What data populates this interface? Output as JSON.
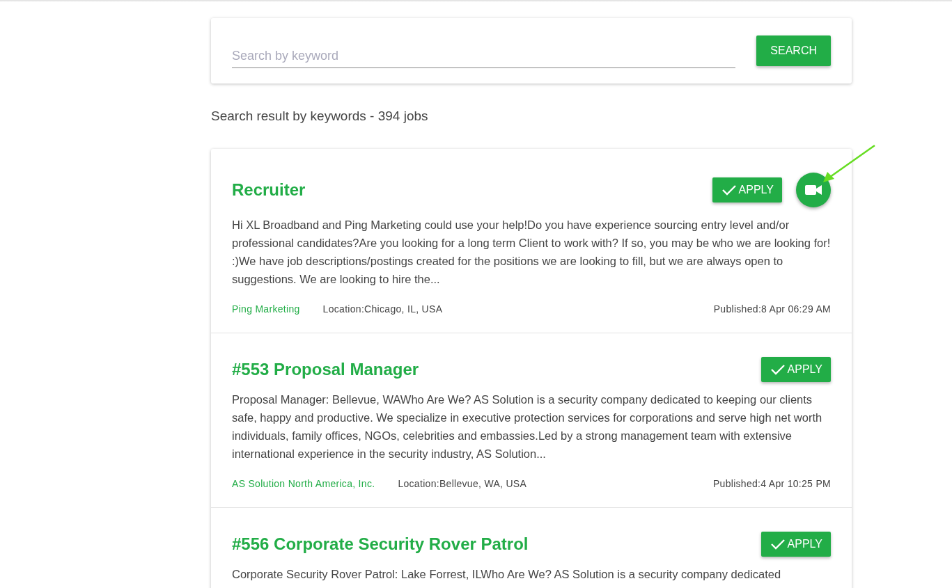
{
  "search": {
    "placeholder": "Search by keyword",
    "button": "SEARCH"
  },
  "result_summary": "Search result by keywords - 394 jobs",
  "jobs": [
    {
      "title": "Recruiter",
      "actions": [
        {
          "kind": "apply",
          "label": "APPLY"
        },
        {
          "kind": "video"
        }
      ],
      "description": "Hi XL Broadband and Ping Marketing could use your help!Do you have experience sourcing entry level and/or professional candidates?Are you looking for a long term Client to work with?  If so, you may be who we are looking for!  :)We have job descriptions/postings created for the positions we are looking to fill, but we are always open to suggestions. We are looking to hire the...",
      "company": "Ping Marketing",
      "location": "Location:Chicago, IL, USA",
      "published": "Published:8 Apr 06:29 AM"
    },
    {
      "title": "#553 Proposal Manager",
      "actions": [
        {
          "kind": "apply",
          "label": "APPLY"
        }
      ],
      "description": "Proposal Manager: Bellevue, WAWho Are We? AS Solution is a security company dedicated to keeping our clients safe, happy and productive. We specialize in executive protection services for corporations and serve high net worth individuals, family offices, NGOs, celebrities and embassies.Led by a strong management team with extensive international experience in the security industry, AS Solution...",
      "company": "AS Solution North America, Inc.",
      "location": "Location:Bellevue, WA, USA",
      "published": "Published:4 Apr 10:25 PM"
    },
    {
      "title": "#556 Corporate Security Rover Patrol",
      "actions": [
        {
          "kind": "apply",
          "label": "APPLY"
        }
      ],
      "description": "Corporate Security Rover Patrol: Lake Forrest, ILWho Are We? AS Solution is a security company dedicated"
    }
  ]
}
